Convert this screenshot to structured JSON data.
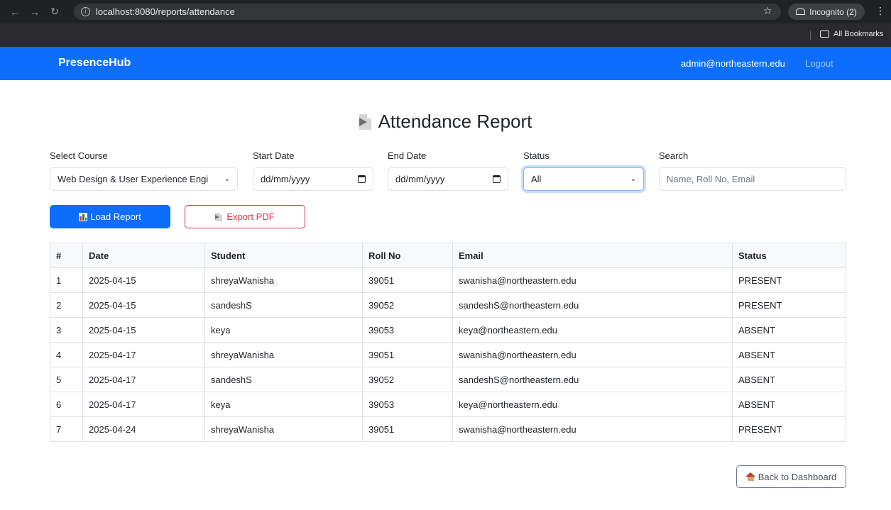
{
  "browser": {
    "url": "localhost:8080/reports/attendance",
    "incognito_label": "Incognito (2)",
    "bookmarks_label": "All Bookmarks"
  },
  "navbar": {
    "brand": "PresenceHub",
    "user_email": "admin@northeastern.edu",
    "logout_label": "Logout",
    "bg_color": "#0d6efd"
  },
  "page": {
    "title": "Attendance Report",
    "title_icon": "document-icon"
  },
  "filters": {
    "course": {
      "label": "Select Course",
      "value": "Web Design & User Experience Engi"
    },
    "start_date": {
      "label": "Start Date",
      "value": "dd/mm/yyyy"
    },
    "end_date": {
      "label": "End Date",
      "value": "dd/mm/yyyy"
    },
    "status": {
      "label": "Status",
      "value": "All"
    },
    "search": {
      "label": "Search",
      "placeholder": "Name, Roll No, Email"
    }
  },
  "actions": {
    "load_label": "Load Report",
    "load_icon": "bar-chart-icon",
    "export_label": "Export PDF",
    "export_icon": "document-icon",
    "back_label": "Back to Dashboard",
    "back_icon": "house-icon"
  },
  "table": {
    "columns": [
      "#",
      "Date",
      "Student",
      "Roll No",
      "Email",
      "Status"
    ],
    "rows": [
      [
        "1",
        "2025-04-15",
        "shreyaWanisha",
        "39051",
        "swanisha@northeastern.edu",
        "PRESENT"
      ],
      [
        "2",
        "2025-04-15",
        "sandeshS",
        "39052",
        "sandeshS@northeastern.edu",
        "PRESENT"
      ],
      [
        "3",
        "2025-04-15",
        "keya",
        "39053",
        "keya@northeastern.edu",
        "ABSENT"
      ],
      [
        "4",
        "2025-04-17",
        "shreyaWanisha",
        "39051",
        "swanisha@northeastern.edu",
        "ABSENT"
      ],
      [
        "5",
        "2025-04-17",
        "sandeshS",
        "39052",
        "sandeshS@northeastern.edu",
        "ABSENT"
      ],
      [
        "6",
        "2025-04-17",
        "keya",
        "39053",
        "keya@northeastern.edu",
        "ABSENT"
      ],
      [
        "7",
        "2025-04-24",
        "shreyaWanisha",
        "39051",
        "swanisha@northeastern.edu",
        "PRESENT"
      ]
    ]
  }
}
